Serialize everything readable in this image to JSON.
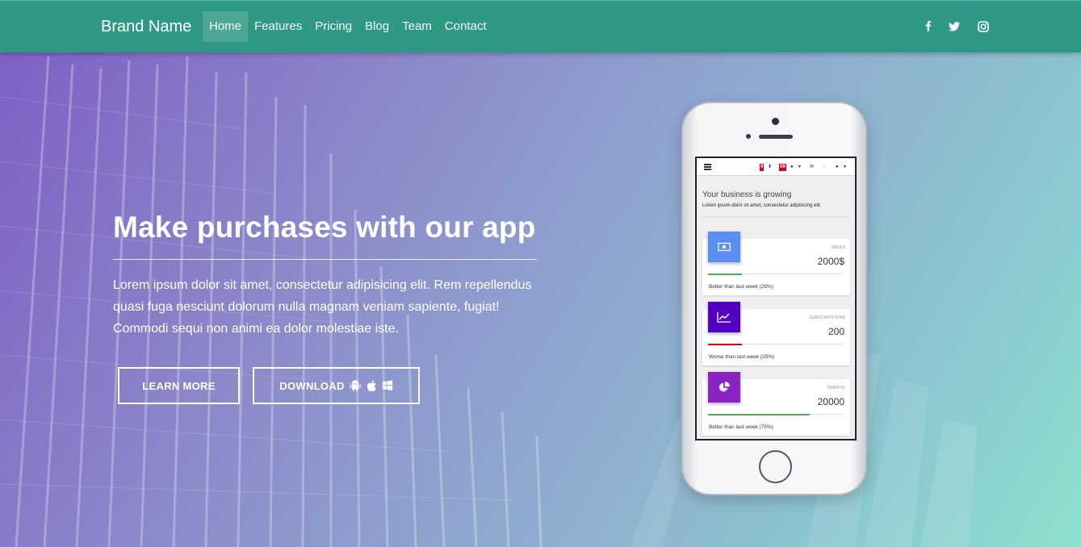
{
  "navbar": {
    "brand": "Brand Name",
    "links": [
      {
        "label": "Home",
        "active": true
      },
      {
        "label": "Features",
        "active": false
      },
      {
        "label": "Pricing",
        "active": false
      },
      {
        "label": "Blog",
        "active": false
      },
      {
        "label": "Team",
        "active": false
      },
      {
        "label": "Contact",
        "active": false
      }
    ],
    "social_icons": [
      "facebook-icon",
      "twitter-icon",
      "instagram-icon"
    ]
  },
  "hero": {
    "headline": "Make purchases with our app",
    "body": "Lorem ipsum dolor sit amet, consectetur adipisicing elit. Rem repellendus quasi fuga nesciunt dolorum nulla magnam veniam sapiente, fugiat! Commodi sequi non animi ea dolor molestiae iste.",
    "learn_more_label": "LEARN MORE",
    "download_label": "DOWNLOAD",
    "download_icons": [
      "android-icon",
      "apple-icon",
      "windows-icon"
    ]
  },
  "phone_app": {
    "badges": [
      "9",
      "99"
    ],
    "title": "Your business is growing",
    "subtitle": "Lorem ipsum dolor sit amet, consectetur adipisicing elit.",
    "cards": [
      {
        "label": "SALES",
        "value": "2000$",
        "footer": "Better than last week (25%)",
        "icon": "money-icon",
        "icon_color": "#5b8ef5",
        "bar_color": "#4caf50",
        "progress_percent": 25
      },
      {
        "label": "SUBSCRIPTIONS",
        "value": "200",
        "footer": "Worse than last week (25%)",
        "icon": "chart-line-icon",
        "icon_color": "#5200c2",
        "bar_color": "#d0021b",
        "progress_percent": 25
      },
      {
        "label": "TRAFFIC",
        "value": "20000",
        "footer": "Better than last week (75%)",
        "icon": "pie-chart-icon",
        "icon_color": "#8c24c4",
        "bar_color": "#4caf50",
        "progress_percent": 75
      }
    ]
  },
  "colors": {
    "navbar": "#2f9986",
    "accent_text": "#ffffff"
  }
}
